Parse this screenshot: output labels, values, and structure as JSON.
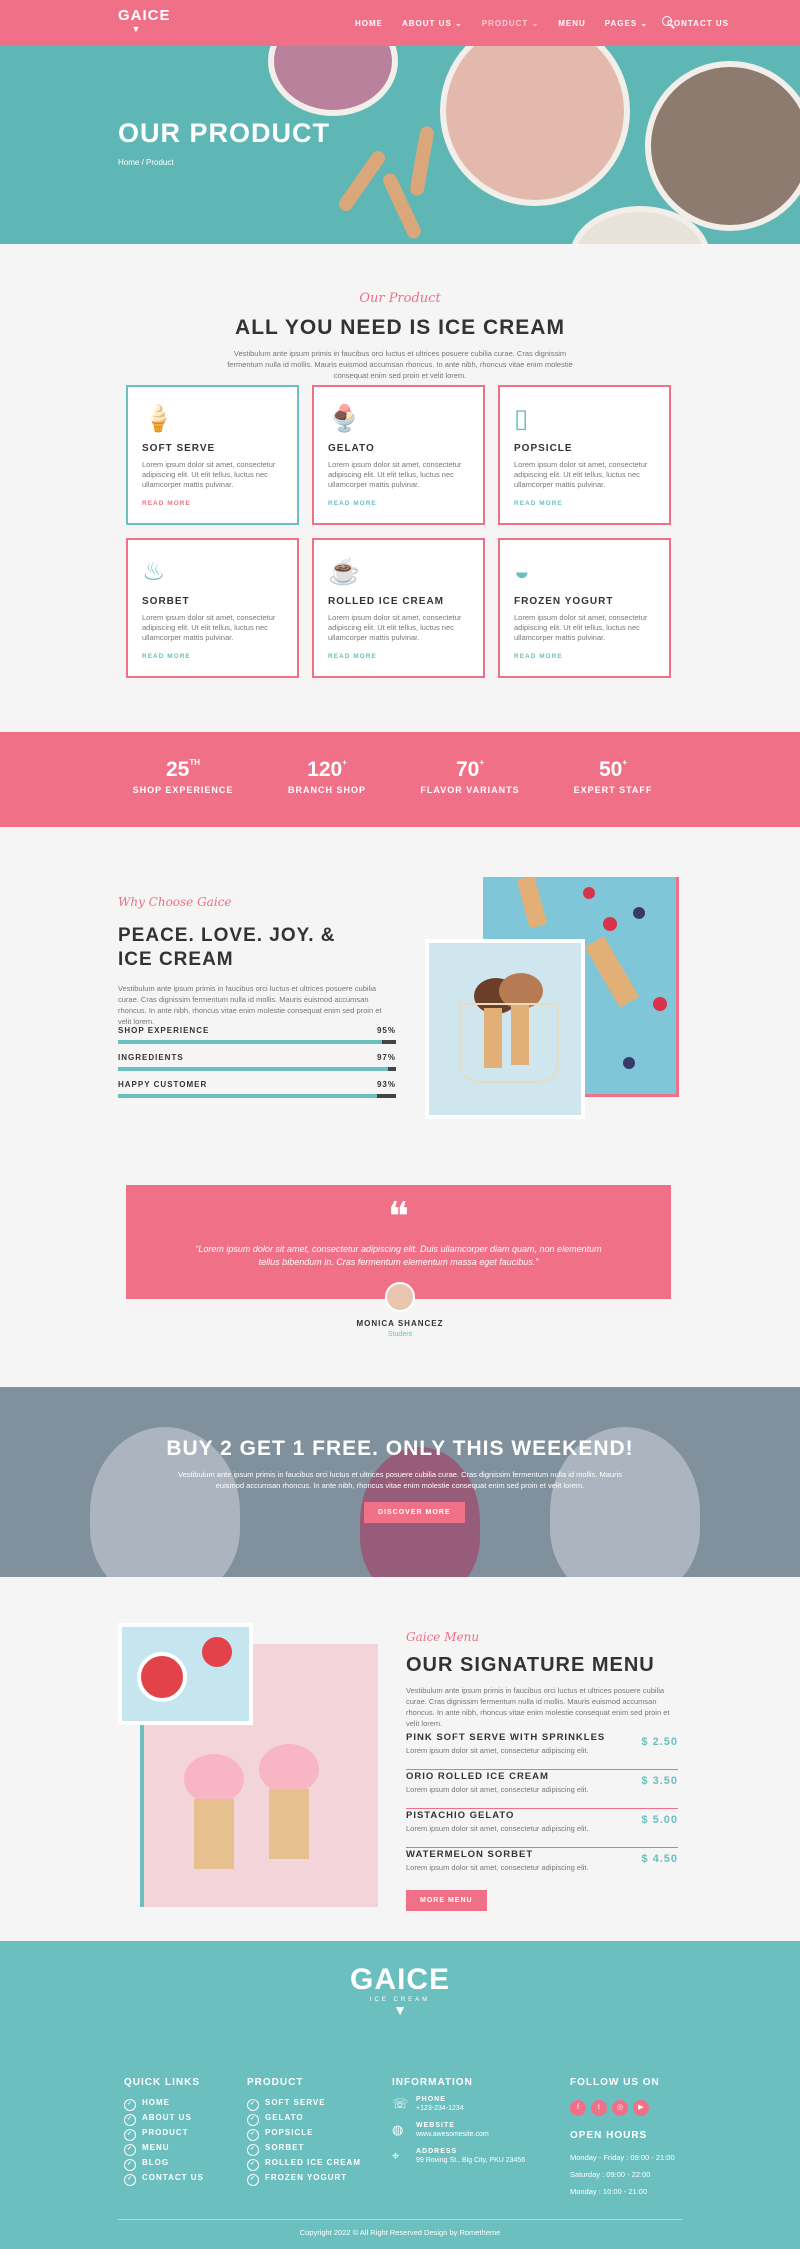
{
  "brand": {
    "name": "GAICE",
    "tagline": "ICE CREAM"
  },
  "nav": {
    "items": [
      "HOME",
      "ABOUT US ⌄",
      "PRODUCT ⌄",
      "MENU",
      "PAGES ⌄",
      "CONTACT US"
    ]
  },
  "hero": {
    "title": "OUR PRODUCT",
    "breadcrumb": "Home / Product"
  },
  "products": {
    "kicker": "Our Product",
    "title": "ALL YOU NEED IS ICE CREAM",
    "lead": "Vestibulum ante ipsum primis in faucibus orci luctus et ultrices posuere cubilia curae. Cras dignissim fermentum nulla id mollis. Mauris euismod accumsan rhoncus. In ante nibh, rhoncus vitae enim molestie consequat enim sed proin et velit lorem.",
    "cards": [
      {
        "icon": "soft-serve-icon",
        "title": "SOFT SERVE",
        "text": "Lorem ipsum dolor sit amet, consectetur adipiscing elit. Ut elit tellus, luctus nec ullamcorper mattis pulvinar.",
        "more": "READ MORE"
      },
      {
        "icon": "gelato-icon",
        "title": "GELATO",
        "text": "Lorem ipsum dolor sit amet, consectetur adipiscing elit. Ut elit tellus, luctus nec ullamcorper mattis pulvinar.",
        "more": "READ MORE"
      },
      {
        "icon": "popsicle-icon",
        "title": "POPSICLE",
        "text": "Lorem ipsum dolor sit amet, consectetur adipiscing elit. Ut elit tellus, luctus nec ullamcorper mattis pulvinar.",
        "more": "READ MORE"
      },
      {
        "icon": "sorbet-icon",
        "title": "SORBET",
        "text": "Lorem ipsum dolor sit amet, consectetur adipiscing elit. Ut elit tellus, luctus nec ullamcorper mattis pulvinar.",
        "more": "READ MORE"
      },
      {
        "icon": "rolled-ice-cream-icon",
        "title": "ROLLED ICE CREAM",
        "text": "Lorem ipsum dolor sit amet, consectetur adipiscing elit. Ut elit tellus, luctus nec ullamcorper mattis pulvinar.",
        "more": "READ MORE"
      },
      {
        "icon": "frozen-yogurt-icon",
        "title": "FROZEN YOGURT",
        "text": "Lorem ipsum dolor sit amet, consectetur adipiscing elit. Ut elit tellus, luctus nec ullamcorper mattis pulvinar.",
        "more": "READ MORE"
      }
    ]
  },
  "stats": [
    {
      "num": "25",
      "sup": "TH",
      "label": "SHOP EXPERIENCE"
    },
    {
      "num": "120",
      "sup": "+",
      "label": "BRANCH SHOP"
    },
    {
      "num": "70",
      "sup": "+",
      "label": "FLAVOR VARIANTS"
    },
    {
      "num": "50",
      "sup": "+",
      "label": "EXPERT STAFF"
    }
  ],
  "why": {
    "kicker": "Why Choose Gaice",
    "title": "PEACE. LOVE. JOY. & ICE CREAM",
    "lead": "Vestibulum ante ipsum primis in faucibus orci luctus et ultrices posuere cubilia curae. Cras dignissim fermentum nulla id mollis. Mauris euismod accumsan rhoncus. In ante nibh, rhoncus vitae enim molestie consequat enim sed proin et velit lorem.",
    "skills": [
      {
        "label": "SHOP EXPERIENCE",
        "value": "95%",
        "pct": 95
      },
      {
        "label": "INGREDIENTS",
        "value": "97%",
        "pct": 97
      },
      {
        "label": "HAPPY CUSTOMER",
        "value": "93%",
        "pct": 93
      }
    ]
  },
  "testimonial": {
    "quote": "“Lorem ipsum dolor sit amet, consectetur adipiscing elit. Duis ullamcorper diam quam, non elementum tellus bibendum in. Cras fermentum elementum massa eget faucibus.”",
    "name": "MONICA SHANCEZ",
    "role": "Student"
  },
  "promo": {
    "title": "BUY 2 GET 1 FREE. ONLY THIS WEEKEND!",
    "lead": "Vestibulum ante ipsum primis in faucibus orci luctus et ultrices posuere cubilia curae. Cras dignissim fermentum nulla id mollis. Mauris euismod accumsan rhoncus. In ante nibh, rhoncus vitae enim molestie consequat enim sed proin et velit lorem.",
    "button": "DISCOVER MORE"
  },
  "signature": {
    "kicker": "Gaice Menu",
    "title": "OUR SIGNATURE MENU",
    "lead": "Vestibulum ante ipsum primis in faucibus orci luctus et ultrices posuere cubilia curae. Cras dignissim fermentum nulla id mollis. Mauris euismod accumsan rhoncus. In ante nibh, rhoncus vitae enim molestie consequat enim sed proin et velit lorem.",
    "items": [
      {
        "name": "PINK SOFT SERVE WITH SPRINKLES",
        "desc": "Lorem ipsum dolor sit amet, consectetur adipiscing elit.",
        "price": "$ 2.50"
      },
      {
        "name": "ORIO ROLLED ICE CREAM",
        "desc": "Lorem ipsum dolor sit amet, consectetur adipiscing elit.",
        "price": "$ 3.50"
      },
      {
        "name": "PISTACHIO GELATO",
        "desc": "Lorem ipsum dolor sit amet, consectetur adipiscing elit.",
        "price": "$ 5.00"
      },
      {
        "name": "WATERMELON SORBET",
        "desc": "Lorem ipsum dolor sit amet, consectetur adipiscing elit.",
        "price": "$ 4.50"
      }
    ],
    "button": "MORE MENU"
  },
  "footer": {
    "quick_title": "QUICK LINKS",
    "quick": [
      "HOME",
      "ABOUT US",
      "PRODUCT",
      "MENU",
      "BLOG",
      "CONTACT US"
    ],
    "product_title": "PRODUCT",
    "product": [
      "SOFT SERVE",
      "GELATO",
      "POPSICLE",
      "SORBET",
      "ROLLED ICE CREAM",
      "FROZEN YOGURT"
    ],
    "info_title": "INFORMATION",
    "info": [
      {
        "icon": "phone-icon",
        "label": "PHONE",
        "value": "+123-234-1234"
      },
      {
        "icon": "globe-icon",
        "label": "WEBSITE",
        "value": "www.awesomesite.com"
      },
      {
        "icon": "location-icon",
        "label": "ADDRESS",
        "value": "99 Roving St., Big City, PKU 23456"
      }
    ],
    "follow_title": "FOLLOW US ON",
    "social": [
      "f",
      "t",
      "◎",
      "▶"
    ],
    "hours_title": "OPEN HOURS",
    "hours": [
      "Monday - Friday : 09:00 - 21:00",
      "Saturday : 09:00 - 22:00",
      "Monday : 10:00 - 21:00"
    ],
    "copyright": "Copyright 2022 © All Right Reserved Design by Rometheme"
  },
  "colors": {
    "pink": "#f07088",
    "teal": "#6cbfbf",
    "bg": "#f5f5f5"
  }
}
